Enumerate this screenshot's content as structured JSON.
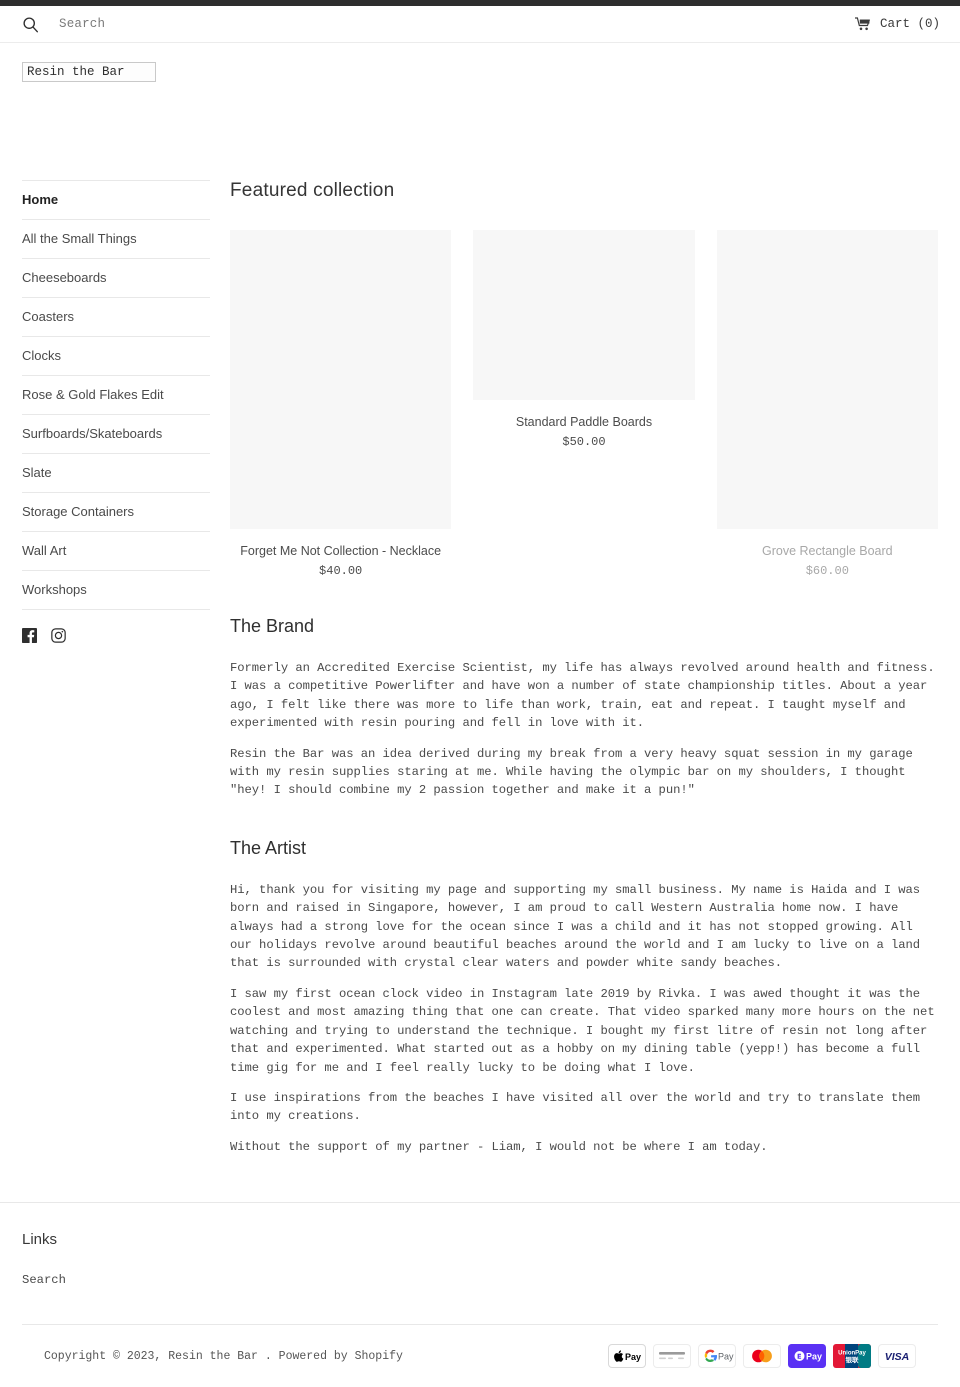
{
  "header": {
    "search_placeholder": "Search",
    "search_value": "",
    "search_icon": "search-icon",
    "cart_icon": "shopping-cart-icon",
    "cart_label": "Cart (0)"
  },
  "logo": {
    "alt_text": "Resin the Bar"
  },
  "sidebar": {
    "items": [
      {
        "label": "Home",
        "active": true
      },
      {
        "label": "All the Small Things",
        "active": false
      },
      {
        "label": "Cheeseboards",
        "active": false
      },
      {
        "label": "Coasters",
        "active": false
      },
      {
        "label": "Clocks",
        "active": false
      },
      {
        "label": "Rose & Gold Flakes Edit",
        "active": false
      },
      {
        "label": "Surfboards/Skateboards",
        "active": false
      },
      {
        "label": "Slate",
        "active": false
      },
      {
        "label": "Storage Containers",
        "active": false
      },
      {
        "label": "Wall Art",
        "active": false
      },
      {
        "label": "Workshops",
        "active": false
      }
    ],
    "social": [
      {
        "name": "facebook-icon"
      },
      {
        "name": "instagram-icon"
      }
    ]
  },
  "featured": {
    "title": "Featured collection",
    "products": [
      {
        "title": "Forget Me Not Collection - Necklace",
        "price": "$40.00",
        "muted": false,
        "thumb": "tall"
      },
      {
        "title": "Standard Paddle Boards",
        "price": "$50.00",
        "muted": false,
        "thumb": "short"
      },
      {
        "title": "Grove Rectangle Board",
        "price": "$60.00",
        "muted": true,
        "thumb": "mid"
      }
    ]
  },
  "brand": {
    "title": "The Brand",
    "paragraphs": [
      "Formerly an Accredited Exercise Scientist, my life has always revolved around health and fitness. I was a competitive Powerlifter and have won a number of state championship titles. About a year ago, I felt like there was more to life than work, train, eat and repeat. I taught myself and experimented with resin pouring and fell in love with it.",
      "Resin the Bar was an idea derived during my break from a very heavy squat session in my garage with my resin supplies staring at me. While having the olympic bar on my shoulders, I thought \"hey! I should combine my 2 passion together and make it a pun!\""
    ]
  },
  "artist": {
    "title": "The Artist",
    "paragraphs": [
      "Hi, thank you for visiting my page and supporting my small business. My name is Haida and I was born and raised in Singapore, however, I am proud to call Western Australia home now. I have always had a strong love for the ocean since I was a child and it has not stopped growing. All our holidays revolve around beautiful beaches around the world and I am lucky to live on a land that is surrounded with crystal clear waters and powder white sandy beaches.",
      "I saw my first ocean clock video in Instagram late 2019 by Rivka. I was awed thought it was the coolest and most amazing thing that one can create. That video sparked many more hours on the net watching and trying to understand the technique. I bought my first litre of resin not long after that and experimented. What started out as a hobby on my dining table (yepp!) has become a full time gig for me and I feel really lucky to be doing what I love.",
      "I use inspirations from the beaches I have visited all over the world and try to translate them into my creations.",
      "Without the support of my partner - Liam, I would not be where I am today."
    ]
  },
  "footer": {
    "links_heading": "Links",
    "links": [
      {
        "label": "Search"
      }
    ],
    "copyright_prefix": "Copyright © 2023,",
    "store_name": "Resin the Bar",
    "copyright_separator": ".",
    "powered_by": "Powered by Shopify",
    "payment_icons": [
      {
        "name": "apple-pay-icon",
        "label": "Pay"
      },
      {
        "name": "generic-card-icon",
        "label": ""
      },
      {
        "name": "google-pay-icon",
        "label": "G Pay"
      },
      {
        "name": "mastercard-icon",
        "label": ""
      },
      {
        "name": "shop-pay-icon",
        "label": "Pay"
      },
      {
        "name": "unionpay-icon",
        "label": "UnionPay"
      },
      {
        "name": "visa-icon",
        "label": "VISA"
      }
    ]
  },
  "colors": {
    "top_bar": "#2e2e2e",
    "placeholder_bg": "#f7f7f7",
    "rule": "#e8e8e8",
    "text": "#4a4a4a",
    "muted_text": "#a8a8a8"
  }
}
